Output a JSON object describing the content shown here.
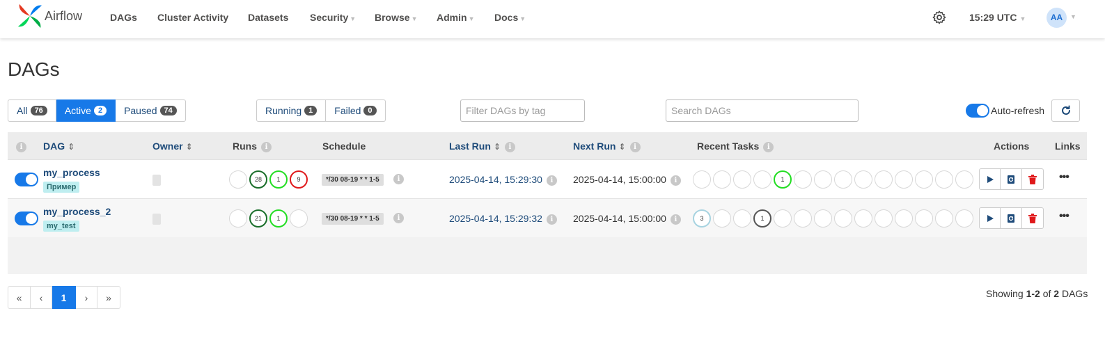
{
  "header": {
    "brand": "Airflow",
    "nav": [
      {
        "label": "DAGs",
        "caret": false
      },
      {
        "label": "Cluster Activity",
        "caret": false
      },
      {
        "label": "Datasets",
        "caret": false
      },
      {
        "label": "Security",
        "caret": true
      },
      {
        "label": "Browse",
        "caret": true
      },
      {
        "label": "Admin",
        "caret": true
      },
      {
        "label": "Docs",
        "caret": true
      }
    ],
    "time": "15:29 UTC",
    "avatar": "AA",
    "settings_icon": "gear-icon"
  },
  "page": {
    "title": "DAGs"
  },
  "filters": {
    "status": [
      {
        "label": "All",
        "count": "76",
        "active": false
      },
      {
        "label": "Active",
        "count": "2",
        "active": true
      },
      {
        "label": "Paused",
        "count": "74",
        "active": false
      }
    ],
    "runs": [
      {
        "label": "Running",
        "count": "1"
      },
      {
        "label": "Failed",
        "count": "0"
      }
    ],
    "tag_placeholder": "Filter DAGs by tag",
    "search_placeholder": "Search DAGs",
    "auto_refresh_label": "Auto-refresh",
    "auto_refresh_on": true
  },
  "table": {
    "headers": {
      "dag": "DAG",
      "owner": "Owner",
      "runs": "Runs",
      "schedule": "Schedule",
      "last_run": "Last Run",
      "next_run": "Next Run",
      "recent_tasks": "Recent Tasks",
      "actions": "Actions",
      "links": "Links"
    },
    "rows": [
      {
        "dag_id": "my_process",
        "tag": "Пример",
        "enabled": true,
        "runs": [
          {
            "count": "",
            "state": "none"
          },
          {
            "count": "28",
            "state": "success"
          },
          {
            "count": "1",
            "state": "running"
          },
          {
            "count": "9",
            "state": "failed"
          }
        ],
        "schedule": "*/30 08-19 * * 1-5",
        "last_run": "2025-04-14, 15:29:30",
        "next_run": "2025-04-14, 15:00:00",
        "recent_tasks": [
          {
            "count": "",
            "state": "none"
          },
          {
            "count": "",
            "state": "none"
          },
          {
            "count": "",
            "state": "none"
          },
          {
            "count": "",
            "state": "none"
          },
          {
            "count": "1",
            "state": "running"
          },
          {
            "count": "",
            "state": "none"
          },
          {
            "count": "",
            "state": "none"
          },
          {
            "count": "",
            "state": "none"
          },
          {
            "count": "",
            "state": "none"
          },
          {
            "count": "",
            "state": "none"
          },
          {
            "count": "",
            "state": "none"
          },
          {
            "count": "",
            "state": "none"
          },
          {
            "count": "",
            "state": "none"
          },
          {
            "count": "",
            "state": "none"
          }
        ]
      },
      {
        "dag_id": "my_process_2",
        "tag": "my_test",
        "enabled": true,
        "runs": [
          {
            "count": "",
            "state": "none"
          },
          {
            "count": "21",
            "state": "success"
          },
          {
            "count": "1",
            "state": "running"
          },
          {
            "count": "",
            "state": "none"
          }
        ],
        "schedule": "*/30 08-19 * * 1-5",
        "last_run": "2025-04-14, 15:29:32",
        "next_run": "2025-04-14, 15:00:00",
        "recent_tasks": [
          {
            "count": "3",
            "state": "queued"
          },
          {
            "count": "",
            "state": "none"
          },
          {
            "count": "",
            "state": "none"
          },
          {
            "count": "1",
            "state": "scheduled"
          },
          {
            "count": "",
            "state": "none"
          },
          {
            "count": "",
            "state": "none"
          },
          {
            "count": "",
            "state": "none"
          },
          {
            "count": "",
            "state": "none"
          },
          {
            "count": "",
            "state": "none"
          },
          {
            "count": "",
            "state": "none"
          },
          {
            "count": "",
            "state": "none"
          },
          {
            "count": "",
            "state": "none"
          },
          {
            "count": "",
            "state": "none"
          },
          {
            "count": "",
            "state": "none"
          }
        ]
      }
    ]
  },
  "pagination": {
    "first": "«",
    "prev": "‹",
    "current": "1",
    "next": "›",
    "last": "»",
    "showing_prefix": "Showing ",
    "range": "1-2",
    "of": " of ",
    "total": "2",
    "suffix": " DAGs"
  },
  "colors": {
    "accent": "#1779e8",
    "link": "#1e4b7a",
    "success": "#1a6e2a",
    "running": "#22dd22",
    "failed": "#e0191b",
    "queued": "#a7d3e0",
    "scheduled": "#555555",
    "delete": "#e0191b"
  }
}
